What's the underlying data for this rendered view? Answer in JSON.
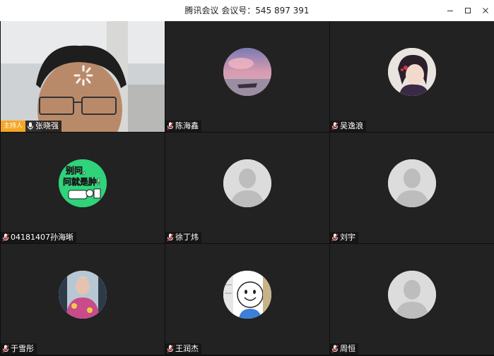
{
  "window": {
    "title": "腾讯会议 会议号：545 897 391",
    "minimize_icon": "minimize-icon",
    "maximize_icon": "maximize-icon",
    "close_icon": "close-icon"
  },
  "host_label": "主持人",
  "participants": [
    {
      "name": "张晓强",
      "is_host": true,
      "mic": "mic-on-icon",
      "view": "video"
    },
    {
      "name": "陈海鑫",
      "mic": "mic-muted-icon",
      "avatar": "sunset-photo-avatar"
    },
    {
      "name": "吴逸浪",
      "mic": "mic-muted-icon",
      "avatar": "anime-character-avatar"
    },
    {
      "name": "04181407孙海晰",
      "mic": "mic-muted-icon",
      "avatar": "green-sticker-avatar"
    },
    {
      "name": "徐丁炜",
      "mic": "mic-muted-icon",
      "avatar": "default-person-avatar"
    },
    {
      "name": "刘宇",
      "mic": "mic-muted-icon",
      "avatar": "default-person-avatar"
    },
    {
      "name": "于雪彤",
      "mic": "mic-muted-icon",
      "avatar": "photo-avatar"
    },
    {
      "name": "王润杰",
      "mic": "mic-muted-icon",
      "avatar": "cartoon-smiley-avatar"
    },
    {
      "name": "周恒",
      "mic": "mic-muted-icon",
      "avatar": "default-person-avatar"
    }
  ],
  "avatar_text": {
    "green_sticker_line1": "别问,",
    "green_sticker_line2": "问就是肿!"
  },
  "colors": {
    "tile_bg": "#222222",
    "grid_gap": "#0e0e0e",
    "host_badge": "#f5a623",
    "muted_red": "#e03a3a",
    "sticker_green": "#2fd37a"
  }
}
